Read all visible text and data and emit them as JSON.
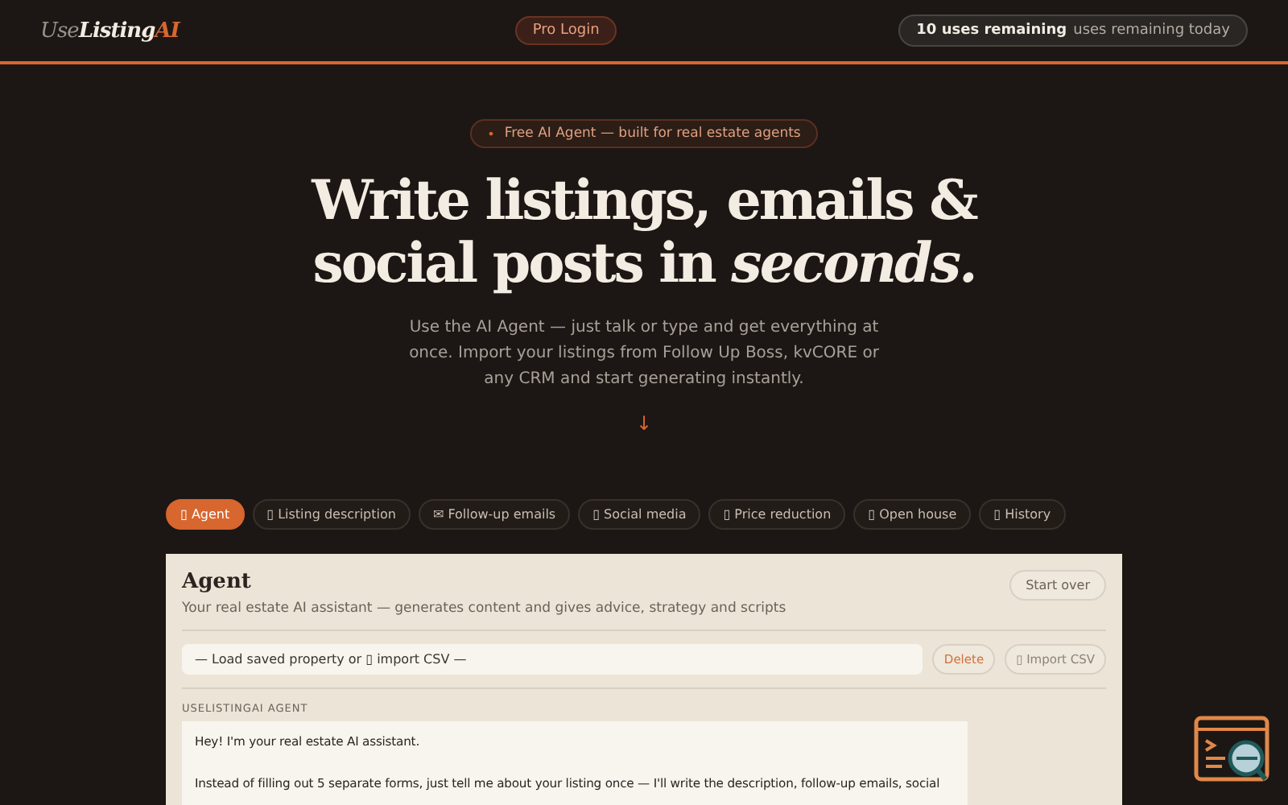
{
  "header": {
    "logo": {
      "prefix": "Use",
      "main": "Listing",
      "suffix": "AI"
    },
    "pro_login": "Pro Login",
    "usage": {
      "count": "10 uses remaining",
      "note": "uses remaining today"
    }
  },
  "hero": {
    "badge": {
      "dot": "•",
      "text": "Free AI Agent — built for real estate agents"
    },
    "headline": "Write listings, emails & social posts in *seconds.*",
    "subtitle": "Use the AI Agent — just talk or type and get everything at once. Import your listings from Follow Up Boss, kvCORE or any CRM and start generating instantly.",
    "arrow": "↓"
  },
  "tabs": [
    {
      "label": "▯ Agent",
      "selected": true
    },
    {
      "label": "▯ Listing description",
      "selected": false
    },
    {
      "label": "✉ Follow-up emails",
      "selected": false
    },
    {
      "label": "▯ Social media",
      "selected": false
    },
    {
      "label": "▯ Price reduction",
      "selected": false
    },
    {
      "label": "▯ Open house",
      "selected": false
    },
    {
      "label": "▯ History",
      "selected": false
    }
  ],
  "panel": {
    "title": "Agent",
    "subtitle": "Your real estate AI assistant — generates content and gives advice, strategy and scripts",
    "start_over": "Start over",
    "property_select": "— Load saved property or ▯ import CSV —",
    "delete": "Delete",
    "import_csv": "▯ Import CSV",
    "agent_label": "USELISTINGAI AGENT",
    "message": [
      "Hey! I'm your real estate AI assistant.",
      "Instead of filling out 5 separate forms, just tell me about your listing once — I'll write the description, follow-up emails, social"
    ]
  }
}
